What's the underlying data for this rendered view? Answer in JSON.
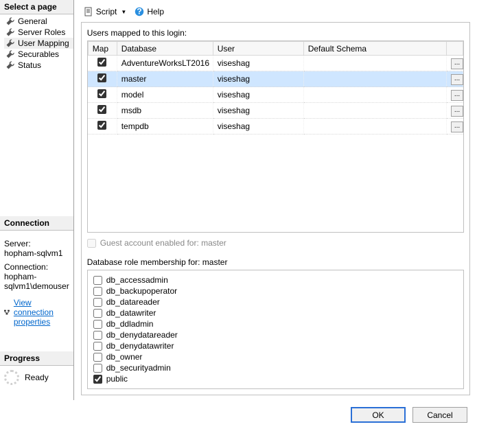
{
  "left": {
    "select_page": "Select a page",
    "nav": [
      {
        "label": "General"
      },
      {
        "label": "Server Roles"
      },
      {
        "label": "User Mapping"
      },
      {
        "label": "Securables"
      },
      {
        "label": "Status"
      }
    ],
    "connection_header": "Connection",
    "server_label": "Server:",
    "server_value": "hopham-sqlvm1",
    "conn_label": "Connection:",
    "conn_value": "hopham-sqlvm1\\demouser",
    "view_conn_link": "View connection properties",
    "progress_header": "Progress",
    "progress_status": "Ready"
  },
  "toolbar": {
    "script": "Script",
    "help": "Help"
  },
  "mapping": {
    "title": "Users mapped to this login:",
    "headers": {
      "map": "Map",
      "db": "Database",
      "user": "User",
      "schema": "Default Schema"
    },
    "rows": [
      {
        "checked": true,
        "db": "AdventureWorksLT2016",
        "user": "viseshag",
        "schema": "",
        "selected": false
      },
      {
        "checked": true,
        "db": "master",
        "user": "viseshag",
        "schema": "",
        "selected": true
      },
      {
        "checked": true,
        "db": "model",
        "user": "viseshag",
        "schema": "",
        "selected": false
      },
      {
        "checked": true,
        "db": "msdb",
        "user": "viseshag",
        "schema": "",
        "selected": false
      },
      {
        "checked": true,
        "db": "tempdb",
        "user": "viseshag",
        "schema": "",
        "selected": false
      }
    ],
    "guest_label": "Guest account enabled for: master"
  },
  "roles": {
    "title": "Database role membership for: master",
    "items": [
      {
        "name": "db_accessadmin",
        "checked": false
      },
      {
        "name": "db_backupoperator",
        "checked": false
      },
      {
        "name": "db_datareader",
        "checked": false
      },
      {
        "name": "db_datawriter",
        "checked": false
      },
      {
        "name": "db_ddladmin",
        "checked": false
      },
      {
        "name": "db_denydatareader",
        "checked": false
      },
      {
        "name": "db_denydatawriter",
        "checked": false
      },
      {
        "name": "db_owner",
        "checked": false
      },
      {
        "name": "db_securityadmin",
        "checked": false
      },
      {
        "name": "public",
        "checked": true
      }
    ]
  },
  "footer": {
    "ok": "OK",
    "cancel": "Cancel"
  }
}
